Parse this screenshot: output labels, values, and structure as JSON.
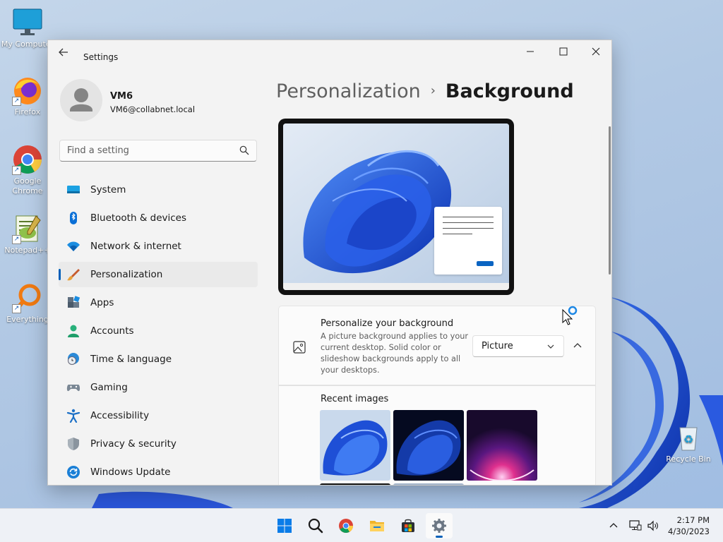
{
  "desktop": {
    "icons": [
      {
        "label": "My Computer"
      },
      {
        "label": "Firefox"
      },
      {
        "label": "Google Chrome"
      },
      {
        "label": "Notepad++"
      },
      {
        "label": "Everything"
      },
      {
        "label": "Recycle Bin"
      }
    ]
  },
  "window": {
    "title": "Settings",
    "controls": {
      "minimize": "minimize",
      "maximize": "maximize",
      "close": "close"
    }
  },
  "profile": {
    "name": "VM6",
    "email": "VM6@collabnet.local"
  },
  "search": {
    "placeholder": "Find a setting"
  },
  "nav": {
    "items": [
      {
        "label": "System",
        "icon": "monitor-icon"
      },
      {
        "label": "Bluetooth & devices",
        "icon": "bluetooth-icon"
      },
      {
        "label": "Network & internet",
        "icon": "wifi-icon"
      },
      {
        "label": "Personalization",
        "icon": "brush-icon",
        "active": true
      },
      {
        "label": "Apps",
        "icon": "apps-icon"
      },
      {
        "label": "Accounts",
        "icon": "person-icon"
      },
      {
        "label": "Time & language",
        "icon": "globe-clock-icon"
      },
      {
        "label": "Gaming",
        "icon": "gamepad-icon"
      },
      {
        "label": "Accessibility",
        "icon": "accessibility-icon"
      },
      {
        "label": "Privacy & security",
        "icon": "shield-icon"
      },
      {
        "label": "Windows Update",
        "icon": "update-icon"
      }
    ]
  },
  "content": {
    "breadcrumb": {
      "parent": "Personalization",
      "separator": "›",
      "current": "Background"
    },
    "personalize_card": {
      "title": "Personalize your background",
      "description": "A picture background applies to your current desktop. Solid color or slideshow backgrounds apply to all your desktops.",
      "dropdown_value": "Picture"
    },
    "recent": {
      "label": "Recent images"
    }
  },
  "taskbar": {
    "apps": [
      "start-icon",
      "search-icon",
      "chrome-icon",
      "file-explorer-icon",
      "store-icon",
      "settings-icon"
    ],
    "time": "2:17 PM",
    "date": "4/30/2023"
  },
  "colors": {
    "accent": "#005fb8",
    "bloom": "#1f4fd8"
  }
}
